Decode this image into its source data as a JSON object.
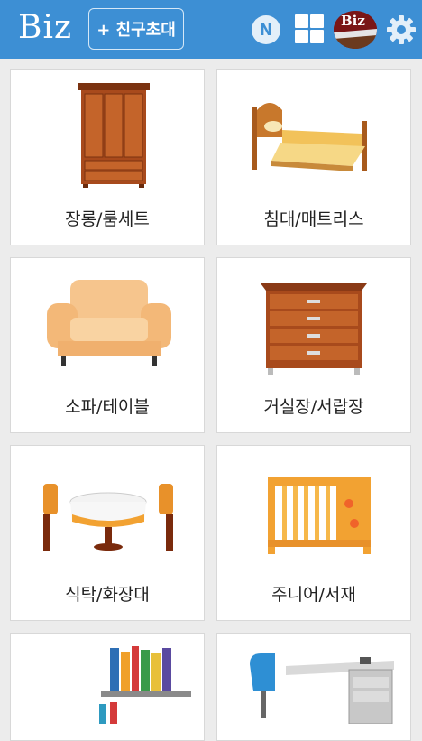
{
  "header": {
    "logo": "Biz",
    "invite_button": "+ 친구초대",
    "n_badge": "N",
    "avatar_label": "Biz"
  },
  "categories": [
    {
      "label": "장롱/룸세트"
    },
    {
      "label": "침대/매트리스"
    },
    {
      "label": "소파/테이블"
    },
    {
      "label": "거실장/서랍장"
    },
    {
      "label": "식탁/화장대"
    },
    {
      "label": "주니어/서재"
    },
    {
      "label": ""
    },
    {
      "label": ""
    }
  ],
  "colors": {
    "accent": "#3d8fd4",
    "background": "#ececec",
    "card": "#ffffff"
  }
}
